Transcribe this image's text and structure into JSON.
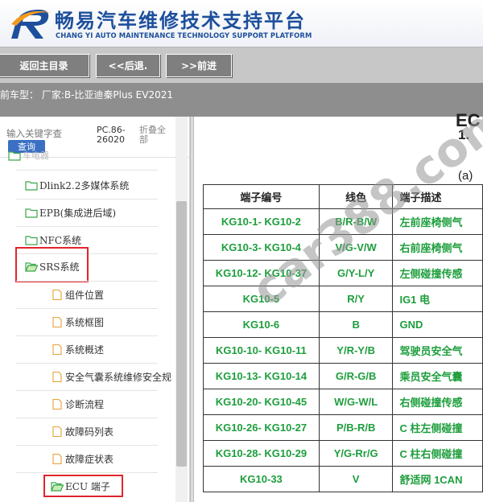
{
  "header": {
    "title": "畅易汽车维修技术支持平台",
    "subtitle": "CHANG YI AUTO MAINTENANCE TECHNOLOGY SUPPORT PLATFORM",
    "logo_icon": "r-swoosh-logo",
    "brand_color": "#1d4f9c"
  },
  "nav": {
    "home_label": "返回主目录",
    "back_label": "<<后退.",
    "forward_label": ">>前进"
  },
  "model_bar": {
    "text": "前车型：  厂家:B-比亚迪秦Plus EV2021"
  },
  "sidebar": {
    "search_placeholder": "输入关键字查",
    "search_button": "查询",
    "version": "PC.86-26020",
    "collapse_all": "折叠全部",
    "partial_item": "车电器",
    "items": [
      {
        "label": "Dlink2.2多媒体系统",
        "icon": "folder-icon"
      },
      {
        "label": "EPB(集成进后域)",
        "icon": "folder-icon"
      },
      {
        "label": "NFC系统",
        "icon": "folder-icon"
      },
      {
        "label": "SRS系统",
        "icon": "folder-open-icon"
      },
      {
        "label": "组件位置",
        "icon": "document-icon"
      },
      {
        "label": "系统框图",
        "icon": "document-icon"
      },
      {
        "label": "系统概述",
        "icon": "document-icon"
      },
      {
        "label": "安全气囊系统维修安全规",
        "icon": "document-icon"
      },
      {
        "label": "诊断流程",
        "icon": "document-icon"
      },
      {
        "label": "故障码列表",
        "icon": "document-icon"
      },
      {
        "label": "故障症状表",
        "icon": "document-icon"
      },
      {
        "label": "ECU 端子",
        "icon": "folder-open-icon"
      }
    ],
    "highlight_color": "#e0252c"
  },
  "content": {
    "heading": "EC",
    "section_number": "1.",
    "sub_label": "(a)",
    "columns": [
      "端子编号",
      "线色",
      "端子描述"
    ],
    "rows": [
      [
        "KG10-1- KG10-2",
        "B/R-B/W",
        "左前座椅侧气"
      ],
      [
        "KG10-3- KG10-4",
        "V/G-V/W",
        "右前座椅侧气"
      ],
      [
        "KG10-12- KG10-37",
        "G/Y-L/Y",
        "左侧碰撞传感"
      ],
      [
        "KG10-5",
        "R/Y",
        "IG1 电"
      ],
      [
        "KG10-6",
        "B",
        "GND"
      ],
      [
        "KG10-10- KG10-11",
        "Y/R-Y/B",
        "驾驶员安全气"
      ],
      [
        "KG10-13- KG10-14",
        "G/R-G/B",
        "乘员安全气囊"
      ],
      [
        "KG10-20- KG10-45",
        "W/G-W/L",
        "右侧碰撞传感"
      ],
      [
        "KG10-26- KG10-27",
        "P/B-R/B",
        "C 柱左侧碰撞"
      ],
      [
        "KG10-28- KG10-29",
        "Y/G-Rr/G",
        "C 柱右侧碰撞"
      ],
      [
        "KG10-33",
        "V",
        "舒适网 1CAN"
      ]
    ],
    "text_color": "#1d9e3c",
    "watermark": "car388.com"
  }
}
